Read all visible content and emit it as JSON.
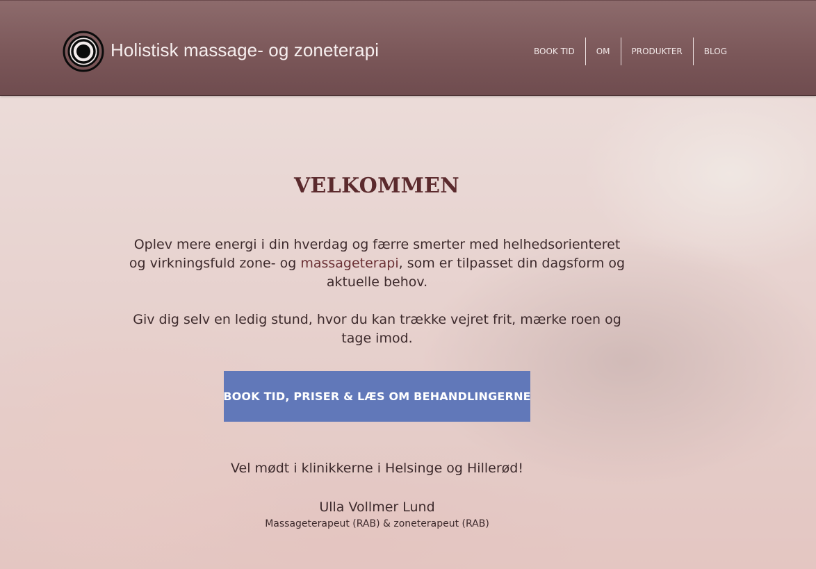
{
  "header": {
    "site_title": "Holistisk massage- og zoneterapi",
    "logo_icon": "concentric-circles-icon",
    "nav": [
      {
        "label": "BOOK TID"
      },
      {
        "label": "OM"
      },
      {
        "label": "PRODUKTER"
      },
      {
        "label": "BLOG"
      }
    ]
  },
  "main": {
    "heading": "VELKOMMEN",
    "intro_part1": "Oplev mere energi i din hverdag og færre smerter med helhedsorienteret og virkningsfuld zone- og ",
    "intro_link": "massageterapi",
    "intro_part2": ", som er tilpasset din dagsform og aktuelle behov.",
    "intro2": "Giv dig selv en ledig stund, hvor du kan trække vejret frit, mærke roen og tage imod.",
    "cta_label": "BOOK TID, PRISER & LÆS OM BEHANDLINGERNE",
    "greeting": "Vel mødt i klinikkerne i Helsinge og Hillerød!",
    "signature_name": "Ulla Vollmer Lund",
    "signature_title": "Massageterapeut (RAB) & zoneterapeut (RAB)"
  },
  "colors": {
    "header_bg": "#7a5658",
    "heading": "#5b2a2d",
    "cta_bg": "#6178b9",
    "body_text": "#3d2a2c"
  }
}
